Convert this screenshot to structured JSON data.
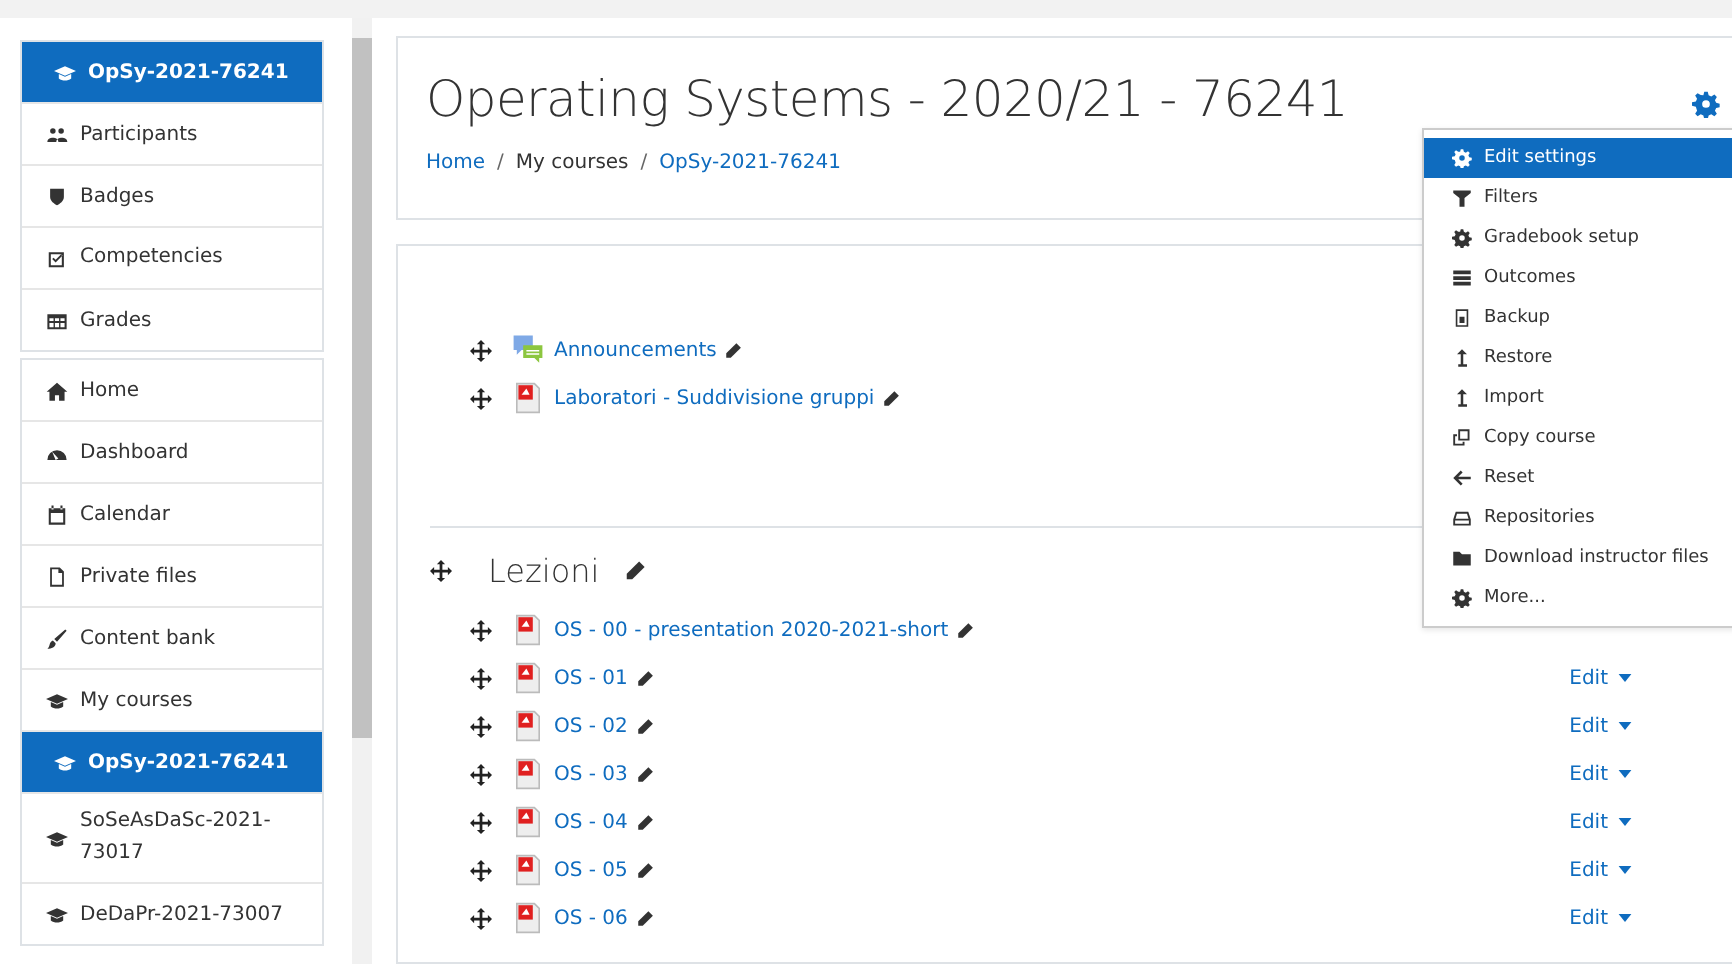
{
  "sidebar": {
    "groups": [
      {
        "items": [
          {
            "label": "OpSy-2021-76241",
            "selected": true
          },
          {
            "label": "Participants",
            "selected": false
          },
          {
            "label": "Badges",
            "selected": false
          },
          {
            "label": "Competencies",
            "selected": false
          },
          {
            "label": "Grades",
            "selected": false
          }
        ]
      },
      {
        "items": [
          {
            "label": "Home",
            "selected": false
          },
          {
            "label": "Dashboard",
            "selected": false
          },
          {
            "label": "Calendar",
            "selected": false
          },
          {
            "label": "Private files",
            "selected": false
          },
          {
            "label": "Content bank",
            "selected": false
          },
          {
            "label": "My courses",
            "selected": false
          },
          {
            "label": "OpSy-2021-76241",
            "selected": true
          },
          {
            "label": "SoSeAsDaSc-2021-73017",
            "selected": false
          },
          {
            "label": "DeDaPr-2021-73007",
            "selected": false
          }
        ]
      }
    ]
  },
  "header": {
    "title": "Operating Systems - 2020/21 - 76241",
    "breadcrumb_separator": "/",
    "breadcrumb": [
      {
        "label": "Home",
        "link": true
      },
      {
        "label": "My courses",
        "link": false
      },
      {
        "label": "OpSy-2021-76241",
        "link": true
      }
    ]
  },
  "settings_menu": {
    "items": [
      {
        "label": "Edit settings",
        "selected": true
      },
      {
        "label": "Filters",
        "selected": false
      },
      {
        "label": "Gradebook setup",
        "selected": false
      },
      {
        "label": "Outcomes",
        "selected": false
      },
      {
        "label": "Backup",
        "selected": false
      },
      {
        "label": "Restore",
        "selected": false
      },
      {
        "label": "Import",
        "selected": false
      },
      {
        "label": "Copy course",
        "selected": false
      },
      {
        "label": "Reset",
        "selected": false
      },
      {
        "label": "Repositories",
        "selected": false
      },
      {
        "label": "Download instructor files",
        "selected": false
      },
      {
        "label": "More...",
        "selected": false
      }
    ]
  },
  "sections": [
    {
      "activities": [
        {
          "kind": "forum",
          "name": "Announcements"
        },
        {
          "kind": "pdf",
          "name": "Laboratori - Suddivisione gruppi"
        }
      ]
    },
    {
      "title": "Lezioni",
      "activities": [
        {
          "kind": "pdf",
          "name": "OS - 00 - presentation 2020-2021-short"
        },
        {
          "kind": "pdf",
          "name": "OS - 01",
          "edit": "Edit"
        },
        {
          "kind": "pdf",
          "name": "OS - 02",
          "edit": "Edit"
        },
        {
          "kind": "pdf",
          "name": "OS - 03",
          "edit": "Edit"
        },
        {
          "kind": "pdf",
          "name": "OS - 04",
          "edit": "Edit"
        },
        {
          "kind": "pdf",
          "name": "OS - 05",
          "edit": "Edit"
        },
        {
          "kind": "pdf",
          "name": "OS - 06",
          "edit": "Edit"
        }
      ]
    }
  ]
}
